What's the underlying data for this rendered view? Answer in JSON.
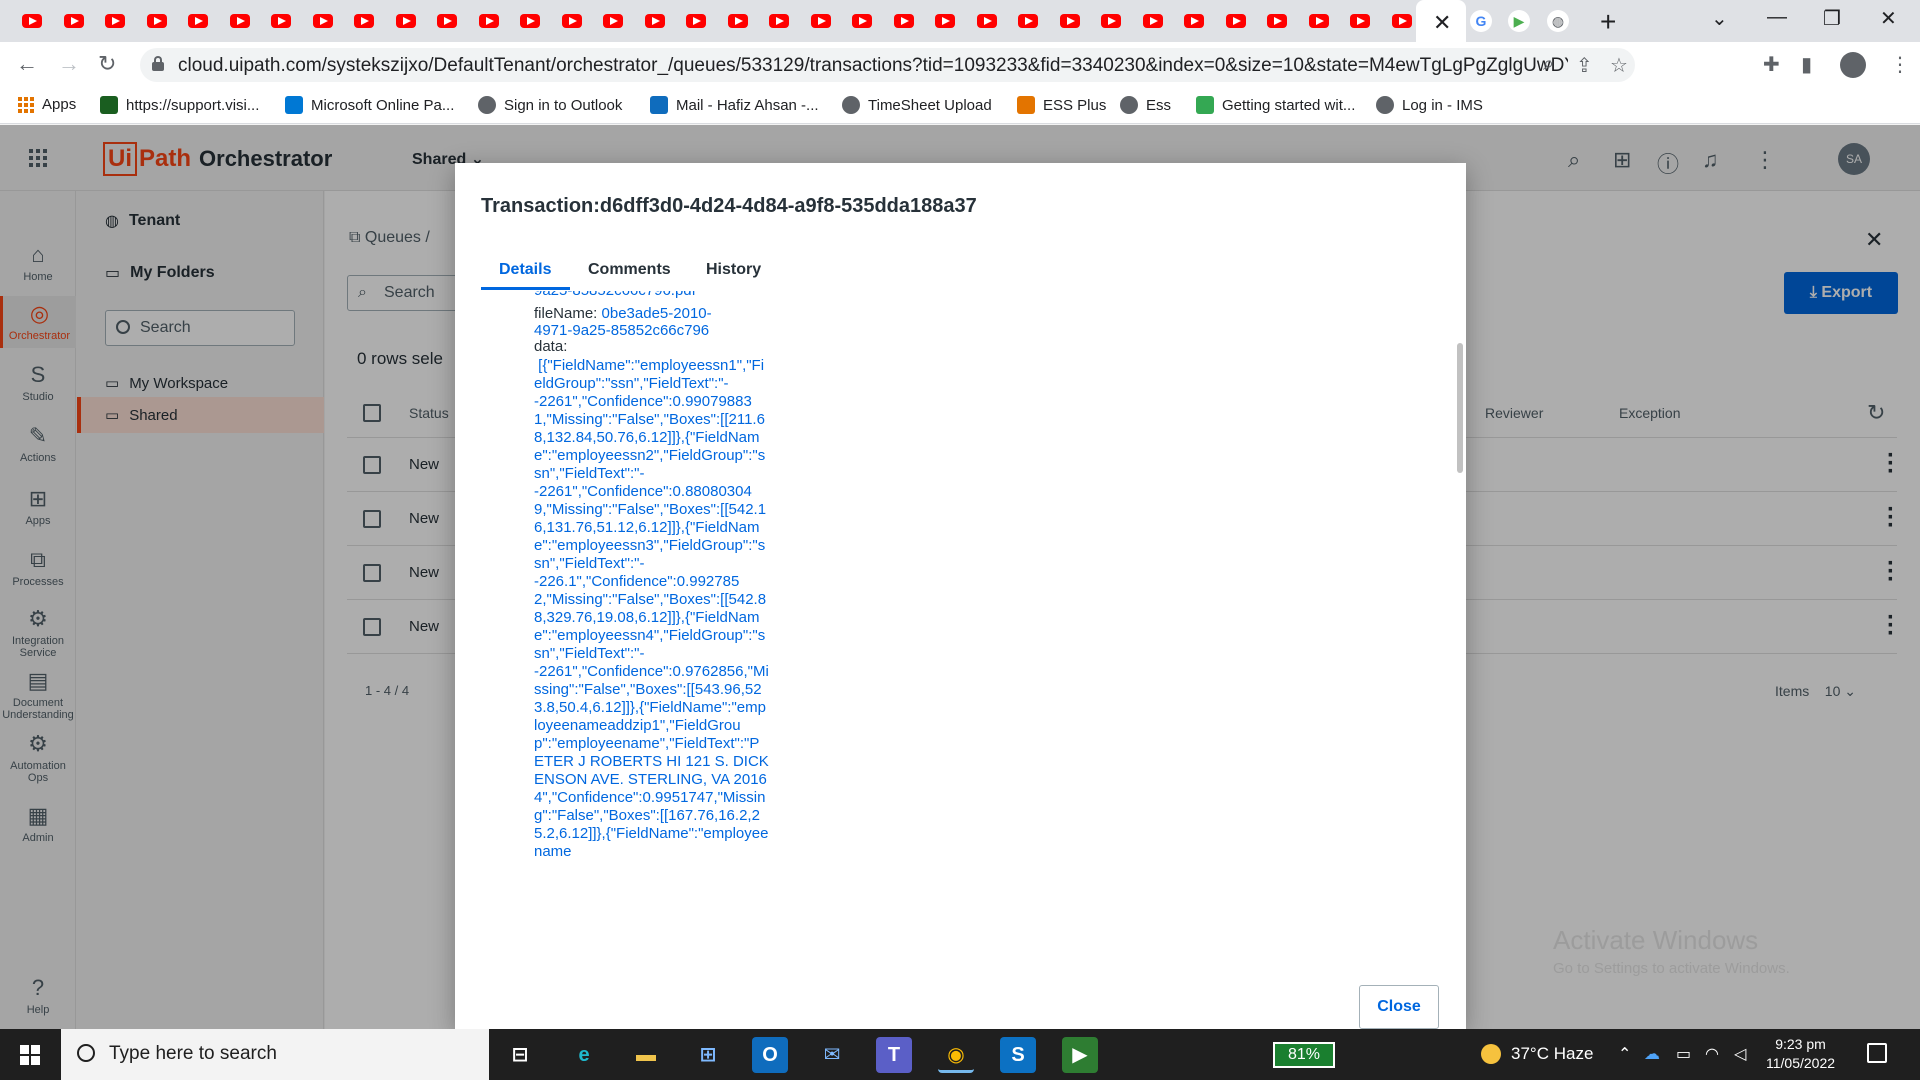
{
  "browser": {
    "youtube_tab_count": 34,
    "active_tab_close": "✕",
    "new_tab": "+",
    "url": "cloud.uipath.com/systekszijxo/DefaultTenant/orchestrator_/queues/533129/transactions?tid=1093233&fid=3340230&index=0&size=10&state=M4ewTgLgPgZglgUwDYBMpzSuYEGMJw...",
    "bookmarks": [
      {
        "label": "Apps",
        "icon": "apps-grid-icon"
      },
      {
        "label": "https://support.visi...",
        "icon": "support-icon"
      },
      {
        "label": "Microsoft Online Pa...",
        "icon": "microsoft-icon"
      },
      {
        "label": "Sign in to Outlook",
        "icon": "globe-icon"
      },
      {
        "label": "Mail - Hafiz Ahsan -...",
        "icon": "outlook-icon"
      },
      {
        "label": "TimeSheet Upload",
        "icon": "globe-icon"
      },
      {
        "label": "ESS Plus",
        "icon": "check-icon"
      },
      {
        "label": "Ess",
        "icon": "globe-icon"
      },
      {
        "label": "Getting started wit...",
        "icon": "android-icon"
      },
      {
        "label": "Log in - IMS",
        "icon": "globe-icon"
      }
    ]
  },
  "header": {
    "logo_ui": "Ui",
    "logo_path": "Path",
    "product": "Orchestrator",
    "folder_selector": "Shared",
    "avatar_initials": "SA"
  },
  "rail": [
    {
      "label": "Home",
      "icon": "home-icon",
      "glyph": "⌂"
    },
    {
      "label": "Orchestrator",
      "icon": "orchestrator-icon",
      "glyph": "◎",
      "active": true
    },
    {
      "label": "Studio",
      "icon": "studio-icon",
      "glyph": "S"
    },
    {
      "label": "Actions",
      "icon": "actions-icon",
      "glyph": "✎"
    },
    {
      "label": "Apps",
      "icon": "apps-icon",
      "glyph": "⊞"
    },
    {
      "label": "Processes",
      "icon": "processes-icon",
      "glyph": "⧉"
    },
    {
      "label": "Integration Service",
      "icon": "integration-icon",
      "glyph": "⚙"
    },
    {
      "label": "Document Understanding",
      "icon": "document-icon",
      "glyph": "▤"
    },
    {
      "label": "Automation Ops",
      "icon": "automation-ops-icon",
      "glyph": "⚙"
    },
    {
      "label": "Admin",
      "icon": "admin-icon",
      "glyph": "▦"
    }
  ],
  "rail_help": "Help",
  "folders": {
    "tenant": "Tenant",
    "my_folders": "My Folders",
    "search_placeholder": "Search",
    "my_workspace": "My Workspace",
    "shared": "Shared"
  },
  "main": {
    "breadcrumb": "Queues  /",
    "search_placeholder": "Search",
    "rows_selected": "0 rows sele",
    "columns": {
      "status": "Status",
      "reviewer": "Reviewer",
      "exception": "Exception"
    },
    "rows": [
      "New",
      "New",
      "New",
      "New"
    ],
    "pagination": "1 - 4 / 4",
    "items_label": "Items",
    "items_per_page": "10",
    "export_label": "Export"
  },
  "modal": {
    "title": "Transaction:d6dff3d0-4d24-4d84-a9f8-535dda188a37",
    "tabs": [
      "Details",
      "Comments",
      "History"
    ],
    "truncated_top": "9a25-85852c66c796.pdf",
    "filename_label": "fileName:",
    "filename_value": "0be3ade5-2010-4971-9a25-85852c66c796",
    "data_label": "data:",
    "data_value": " [{\"FieldName\":\"employeessn1\",\"FieldGroup\":\"ssn\",\"FieldText\":\"-\n-2261\",\"Confidence\":0.990798831,\"Missing\":\"False\",\"Boxes\":[[211.68,132.84,50.76,6.12]]},{\"FieldName\":\"employeessn2\",\"FieldGroup\":\"ssn\",\"FieldText\":\"-\n-2261\",\"Confidence\":0.880803049,\"Missing\":\"False\",\"Boxes\":[[542.16,131.76,51.12,6.12]]},{\"FieldName\":\"employeessn3\",\"FieldGroup\":\"ssn\",\"FieldText\":\"-\n-226.1\",\"Confidence\":0.9927852,\"Missing\":\"False\",\"Boxes\":[[542.88,329.76,19.08,6.12]]},{\"FieldName\":\"employeessn4\",\"FieldGroup\":\"ssn\",\"FieldText\":\"-\n-2261\",\"Confidence\":0.9762856,\"Missing\":\"False\",\"Boxes\":[[543.96,523.8,50.4,6.12]]},{\"FieldName\":\"employeenameaddzip1\",\"FieldGroup\":\"employeename\",\"FieldText\":\"PETER J ROBERTS HI 121 S. DICKENSON AVE. STERLING, VA 20164\",\"Confidence\":0.9951747,\"Missing\":\"False\",\"Boxes\":[[167.76,16.2,25.2,6.12]]},{\"FieldName\":\"employeename",
    "close_label": "Close"
  },
  "watermark": {
    "line1": "Activate Windows",
    "line2": "Go to Settings to activate Windows."
  },
  "taskbar": {
    "search_placeholder": "Type here to search",
    "battery": "81%",
    "weather": "37°C  Haze",
    "time": "9:23 pm",
    "date": "11/05/2022"
  }
}
